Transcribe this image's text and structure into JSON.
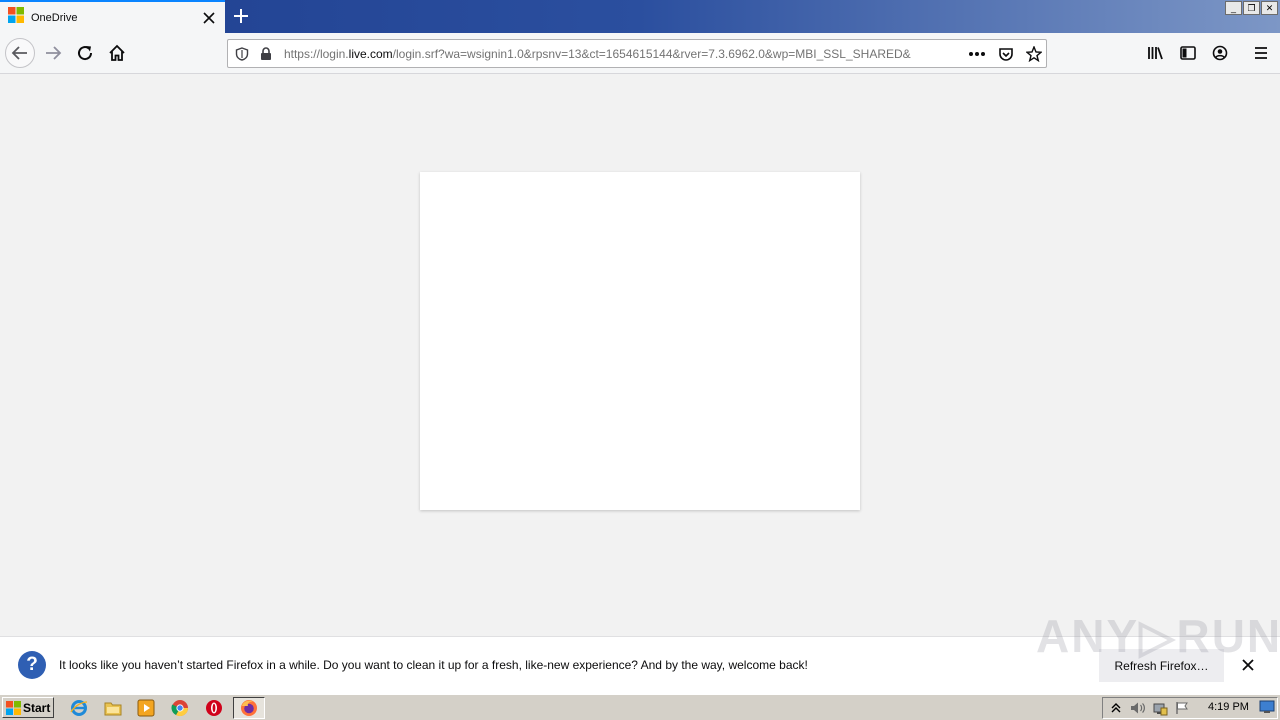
{
  "tab": {
    "title": "OneDrive"
  },
  "window_controls": {
    "minimize": "_",
    "restore": "❐",
    "close": "✕"
  },
  "url": {
    "prefix": "https://login.",
    "host": "live.com",
    "rest": "/login.srf?wa=wsignin1.0&rpsnv=13&ct=1654615144&rver=7.3.6962.0&wp=MBI_SSL_SHARED&"
  },
  "notification": {
    "message": "It looks like you haven’t started Firefox in a while. Do you want to clean it up for a fresh, like-new experience? And by the way, welcome back!",
    "button": "Refresh Firefox…"
  },
  "watermark": "ANY▷RUN",
  "taskbar": {
    "start_label": "Start",
    "clock": "4:19 PM"
  },
  "colors": {
    "tab_accent": "#0a84ff",
    "notif_icon": "#2f5fb3",
    "titlebar": "#1f3f8f"
  }
}
